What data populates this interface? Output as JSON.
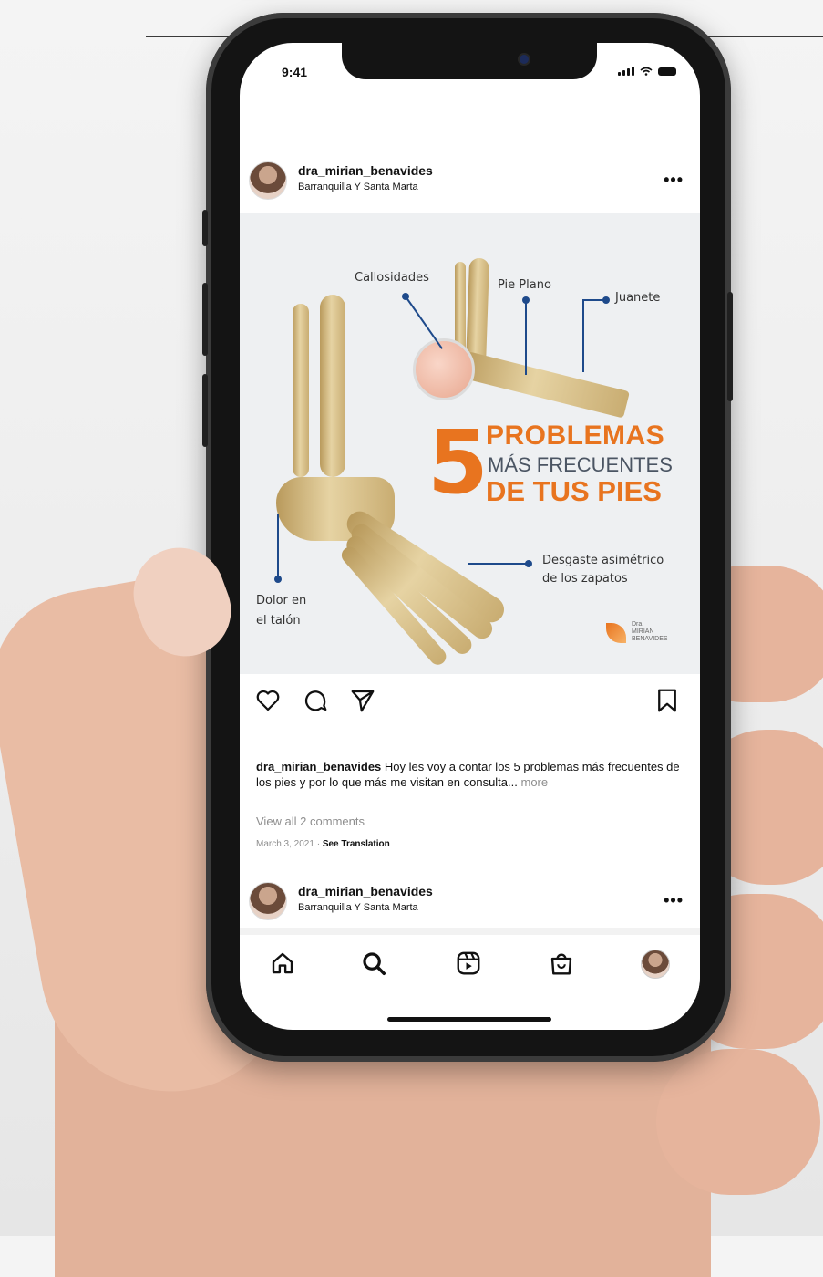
{
  "status_bar": {
    "time": "9:41"
  },
  "post": {
    "username": "dra_mirian_benavides",
    "location": "Barranquilla Y Santa Marta",
    "more": "•••",
    "image": {
      "labels": {
        "callosidades": "Callosidades",
        "pie_plano": "Pie Plano",
        "juanete": "Juanete",
        "dolor_line1": "Dolor en",
        "dolor_line2": "el talón",
        "desgaste_line1": "Desgaste asimétrico",
        "desgaste_line2": "de los zapatos"
      },
      "headline": {
        "number": "5",
        "line1": "PROBLEMAS",
        "line2": "MÁS FRECUENTES",
        "line3": "DE TUS PIES"
      },
      "logo": {
        "line1": "Dra.",
        "line2": "MIRIAN",
        "line3": "BENAVIDES"
      }
    },
    "caption": {
      "username": "dra_mirian_benavides",
      "text": "Hoy les voy a contar los 5 problemas más frecuentes de los pies y por lo que más me visitan en consulta...",
      "more": "more"
    },
    "view_comments": "View all 2 comments",
    "date": "March 3, 2021",
    "separator": " · ",
    "see_translation": "See Translation"
  },
  "next_post": {
    "username": "dra_mirian_benavides",
    "location": "Barranquilla Y Santa Marta",
    "more": "•••"
  },
  "tab_bar": [
    "home-icon",
    "search-icon",
    "reels-icon",
    "shop-icon",
    "profile-avatar"
  ],
  "colors": {
    "accent_orange": "#e8741f",
    "label_blue": "#1e4a8b"
  }
}
